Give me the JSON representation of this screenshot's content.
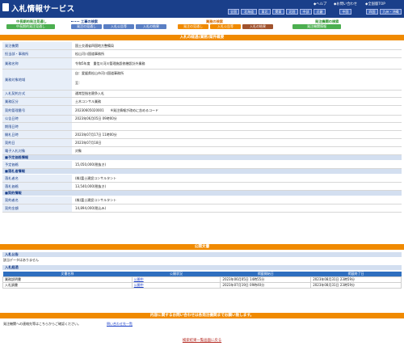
{
  "header": {
    "title": "入札情報サービス",
    "top_links": [
      "ヘルプ",
      "お問い合わせ",
      "全国版TOP"
    ],
    "regions": [
      "全国",
      "北海道",
      "東北",
      "関東",
      "北陸",
      "中部",
      "近畿",
      "中国",
      "四国",
      "九州・沖縄"
    ]
  },
  "nav": {
    "groups": [
      {
        "heading": "中長期的発注見通し",
        "tabs": [
          "中長期的発注見通し"
        ]
      },
      {
        "heading": "工事の検索",
        "tabs": [
          "発注の見通し",
          "入札公告等",
          "入札の結果"
        ]
      },
      {
        "heading": "業務の検索",
        "tabs": [
          "発注の見通し",
          "入札公告等",
          "入札の結果"
        ]
      },
      {
        "heading": "発注機関の検索",
        "tabs": [
          "発注機関情報"
        ]
      }
    ]
  },
  "main": {
    "section_title": "入札の経過(業務)案件概要",
    "rows": [
      {
        "label": "発注機関",
        "value": "国土交通省四国地方整備局"
      },
      {
        "label": "担当部・事務所",
        "value": "松山河川国道事務所"
      },
      {
        "label": "業務名称",
        "value": "令和5年度　重信川河川管理施設修繕設計外業務"
      },
      {
        "label": "業務対象地域",
        "value": "自：愛媛県松山市河川国道事務所",
        "value2": "至："
      },
      {
        "label": "入札契約方式",
        "value": "通常型指名競争入札"
      },
      {
        "label": "業務区分",
        "value": "土木コンサル業務"
      },
      {
        "label": "契約管理番号",
        "value": "20230605020001　　※発注情報が改めに含めるコード"
      },
      {
        "label": "公告日時",
        "value": "2023年06月05日 09時00分"
      },
      {
        "label": "期限日時",
        "value": ""
      },
      {
        "label": "開札日時",
        "value": "2023年07月17日 11時00分"
      },
      {
        "label": "契約日",
        "value": "2023年07月18日"
      },
      {
        "label": "電子入札対象",
        "value": "対象"
      }
    ],
    "yotei_heading": "■予定価格情報",
    "yotei_label": "予定価格",
    "yotei_value": "15,050,000(税抜き)",
    "rakusatsu_heading": "■落札者情報",
    "rakusatsu_rows": [
      {
        "label": "落札者名",
        "value": "(株)富士建設コンサルタント"
      },
      {
        "label": "落札価格",
        "value": "13,540,000(税抜き)"
      }
    ],
    "keiyaku_heading": "■契約情報",
    "keiyaku_rows": [
      {
        "label": "契約者名",
        "value": "(株)富士建設コンサルタント"
      },
      {
        "label": "契約金額",
        "value": "14,894,000(税込み)"
      }
    ]
  },
  "public_docs": {
    "section_title": "公開文書",
    "notice_label": "入札公告",
    "notice_value": "該当データはありません",
    "progress_label": "入札経過",
    "columns": [
      "文書名称",
      "公開状況",
      "掲載開始日",
      "掲載終了日"
    ],
    "rows": [
      {
        "name": "業務説明書",
        "status": "公開中",
        "start": "2023年06月05日 14時55分",
        "end": "2023年08月31日 23時59分"
      },
      {
        "name": "入札調書",
        "status": "公開中",
        "start": "2023年07月19日 09時40分",
        "end": "2023年08月31日 23時59分"
      }
    ]
  },
  "contact": {
    "section_title": "内容に関するお問い合わせは各発注機関までお願い致します。",
    "text": "発注機関への連絡先等はこちらからご確認ください。",
    "link": "問い合わせ先一覧"
  },
  "footer": {
    "back_link": "検索結果一覧画面に戻る"
  }
}
